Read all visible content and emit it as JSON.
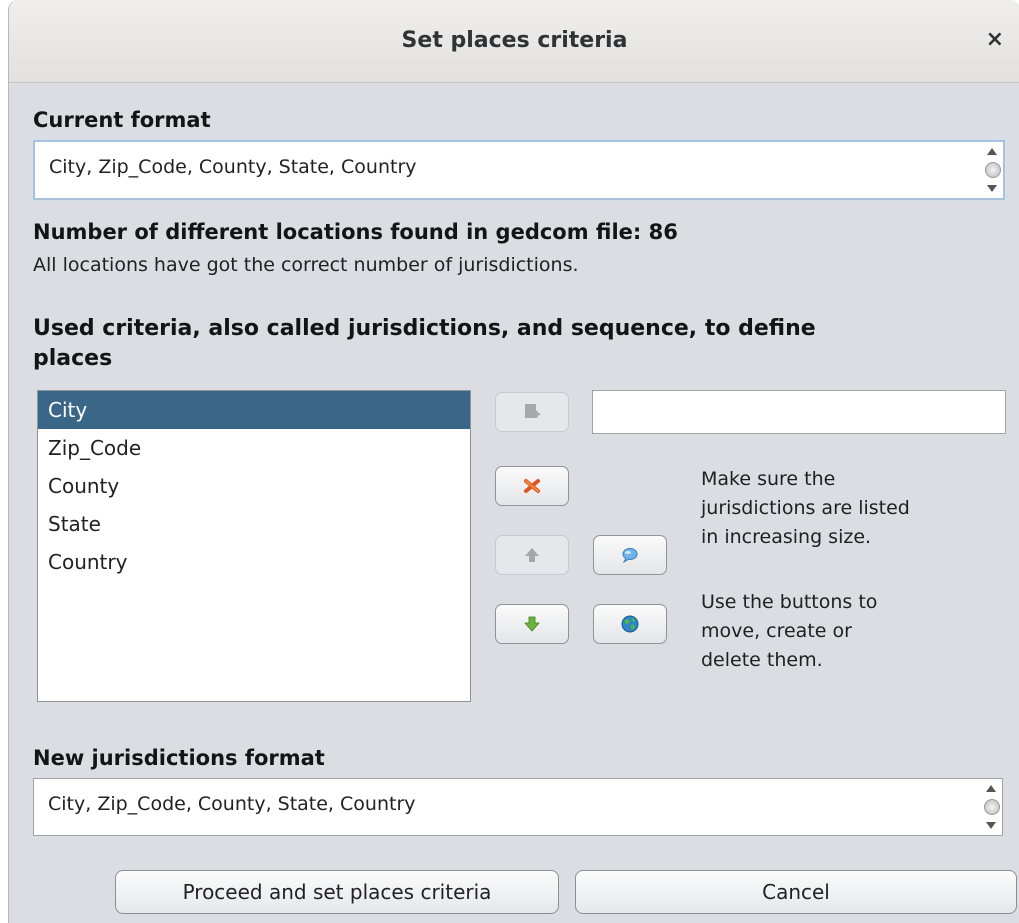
{
  "dialog": {
    "title": "Set places criteria",
    "close_glyph": "×"
  },
  "current_format": {
    "label": "Current format",
    "value": "City, Zip_Code, County, State, Country"
  },
  "locations": {
    "count_label": "Number of different locations found in gedcom file: 86",
    "status": "All locations have got the correct number of jurisdictions."
  },
  "criteria": {
    "heading_line1": "Used criteria, also called jurisdictions, and sequence, to define",
    "heading_line2": "places",
    "items": [
      "City",
      "Zip_Code",
      "County",
      "State",
      "Country"
    ],
    "selected_index": 0,
    "new_item_value": ""
  },
  "help": {
    "line1": "Make sure the",
    "line2": "jurisdictions are listed",
    "line3": "in increasing size.",
    "line4": "Use the buttons to",
    "line5": "move, create or",
    "line6": "delete them."
  },
  "icons": {
    "add": "add-jurisdiction-icon",
    "delete": "delete-jurisdiction-icon",
    "up": "move-up-icon",
    "down": "move-down-icon",
    "lookup": "lookup-icon",
    "globe": "globe-icon"
  },
  "new_format": {
    "label": "New jurisdictions format",
    "value": "City, Zip_Code, County, State, Country"
  },
  "buttons": {
    "proceed": "Proceed and set places criteria",
    "cancel": "Cancel"
  },
  "colors": {
    "selection": "#3a6788",
    "background": "#dbdde2"
  }
}
